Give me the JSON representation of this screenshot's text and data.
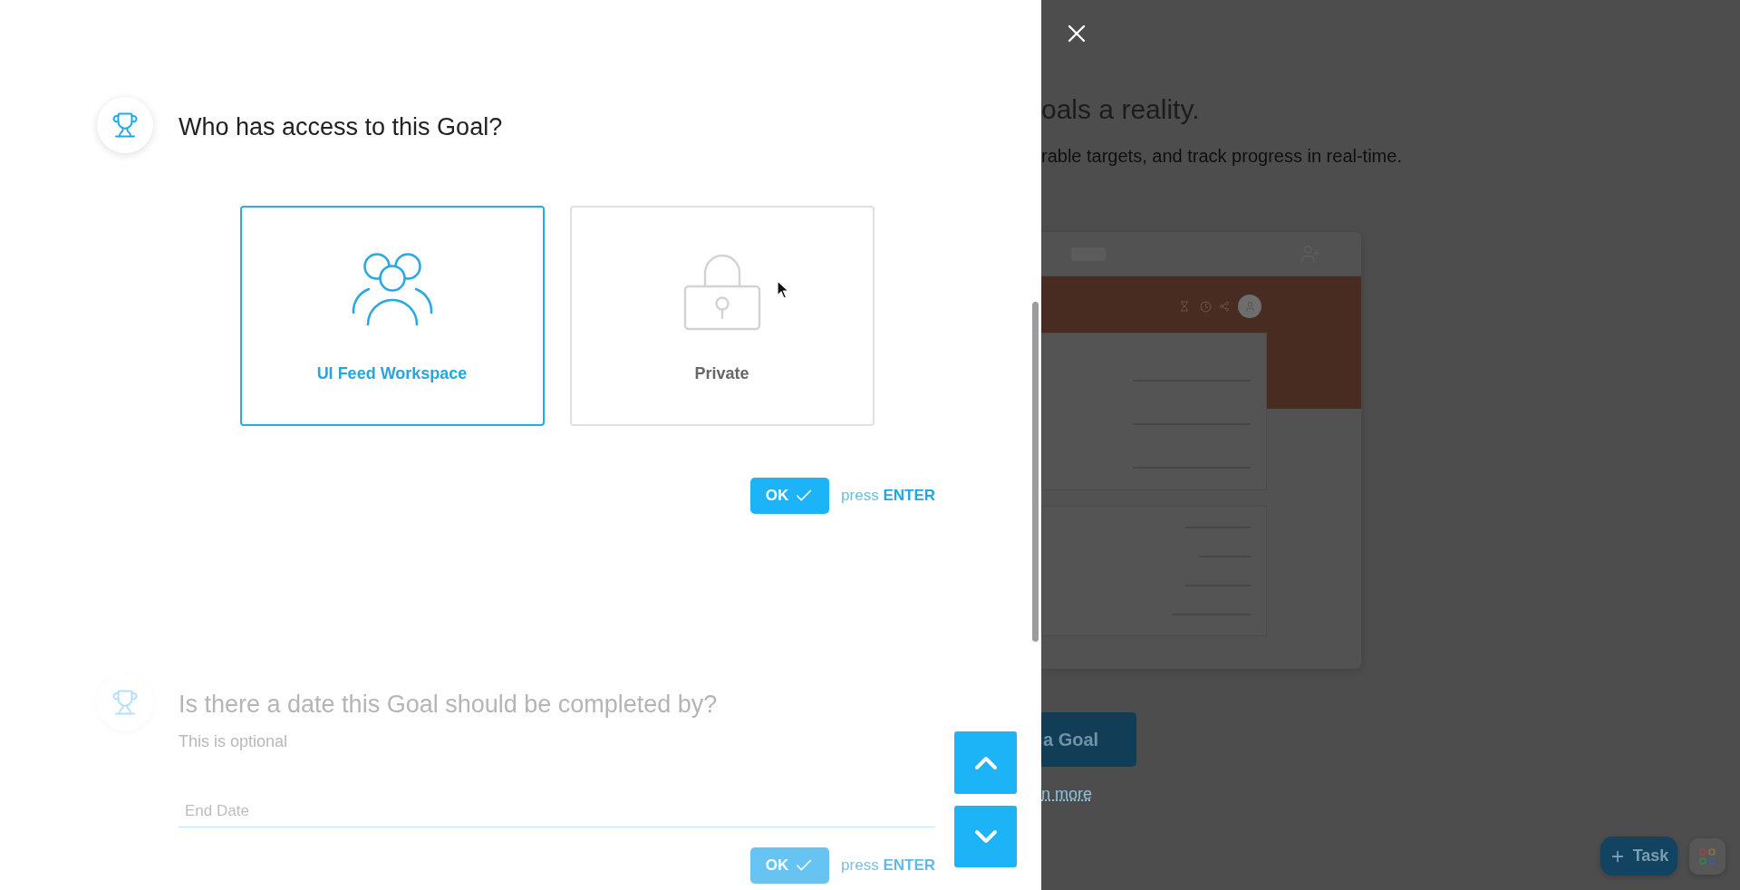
{
  "questions": [
    {
      "kind": "choice",
      "active": true,
      "title": "Who has access to this Goal?",
      "options": [
        {
          "kind": "team",
          "label": "UI Feed Workspace",
          "selected": true
        },
        {
          "kind": "lock",
          "label": "Private",
          "selected": false
        }
      ],
      "ok_button": {
        "label": "OK"
      },
      "hint": "press **ENTER**"
    },
    {
      "kind": "date",
      "active": false,
      "title": "Is there a date this Goal should be completed by?",
      "subtitle": "This is optional",
      "field": {
        "placeholder": "End Date"
      },
      "ok_button": {
        "label": "OK"
      },
      "hint": "press **ENTER**"
    }
  ],
  "background_page": {
    "heading": "oals a reality.",
    "subheading": "rable targets, and track progress in real-time.",
    "button": {
      "label": "a Goal"
    },
    "link": {
      "label": "n more"
    }
  },
  "task_button": {
    "label": "Task"
  }
}
